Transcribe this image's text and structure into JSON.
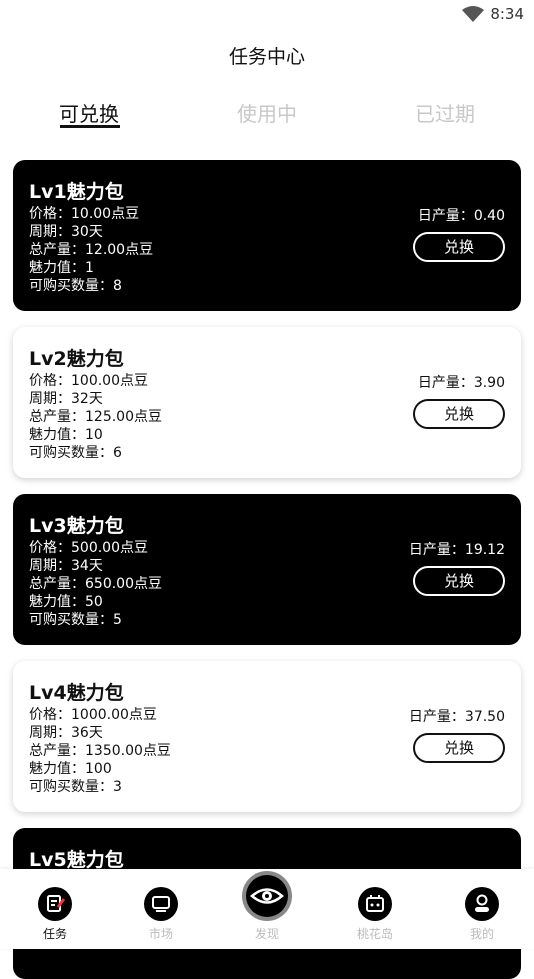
{
  "status_bar": {
    "time": "8:34"
  },
  "header": {
    "title": "任务中心"
  },
  "tabs": [
    {
      "label": "可兑换"
    },
    {
      "label": "使用中"
    },
    {
      "label": "已过期"
    }
  ],
  "cards": [
    {
      "title": "Lv1魅力包",
      "price": "价格：10.00点豆",
      "period": "周期：30天",
      "total": "总产量：12.00点豆",
      "charm": "魅力值：1",
      "quantity": "可购买数量：8",
      "daily": "日产量：0.40",
      "button": "兑换",
      "theme": "dark"
    },
    {
      "title": "Lv2魅力包",
      "price": "价格：100.00点豆",
      "period": "周期：32天",
      "total": "总产量：125.00点豆",
      "charm": "魅力值：10",
      "quantity": "可购买数量：6",
      "daily": "日产量：3.90",
      "button": "兑换",
      "theme": "light"
    },
    {
      "title": "Lv3魅力包",
      "price": "价格：500.00点豆",
      "period": "周期：34天",
      "total": "总产量：650.00点豆",
      "charm": "魅力值：50",
      "quantity": "可购买数量：5",
      "daily": "日产量：19.12",
      "button": "兑换",
      "theme": "dark"
    },
    {
      "title": "Lv4魅力包",
      "price": "价格：1000.00点豆",
      "period": "周期：36天",
      "total": "总产量：1350.00点豆",
      "charm": "魅力值：100",
      "quantity": "可购买数量：3",
      "daily": "日产量：37.50",
      "button": "兑换",
      "theme": "light"
    },
    {
      "title": "Lv5魅力包",
      "theme": "dark"
    }
  ],
  "bottom_nav": [
    {
      "label": "任务",
      "icon": "task-icon"
    },
    {
      "label": "市场",
      "icon": "market-icon"
    },
    {
      "label": "发现",
      "icon": "eye-icon"
    },
    {
      "label": "桃花岛",
      "icon": "island-icon"
    },
    {
      "label": "我的",
      "icon": "profile-icon"
    }
  ],
  "colors": {
    "dark_card": "#000000",
    "active_text": "#111111",
    "inactive_text": "#c8c8c8"
  }
}
